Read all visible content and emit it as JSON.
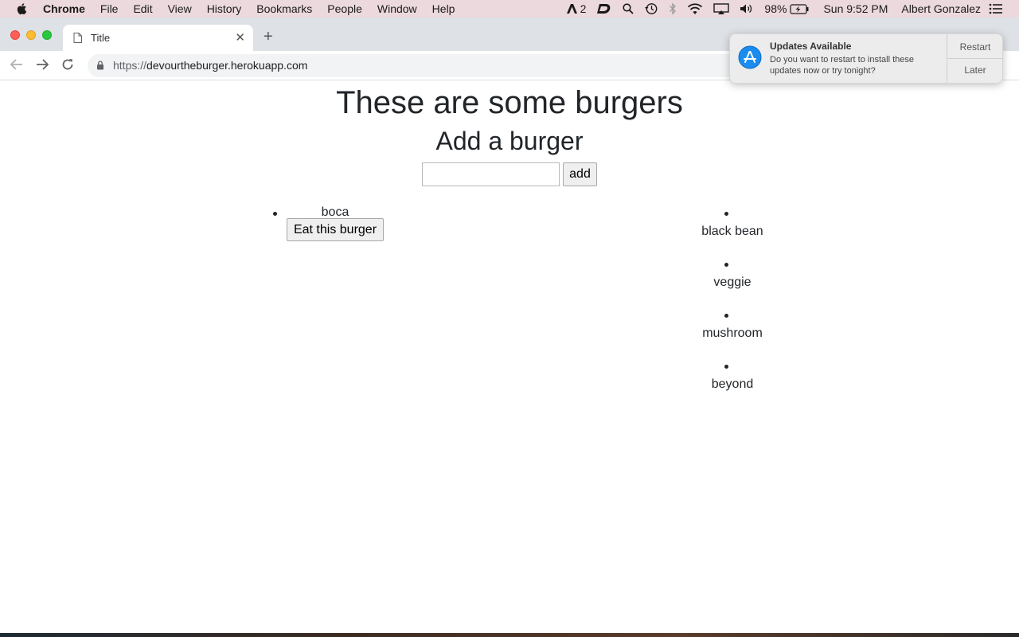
{
  "menubar": {
    "app_name": "Chrome",
    "items": [
      "File",
      "Edit",
      "View",
      "History",
      "Bookmarks",
      "People",
      "Window",
      "Help"
    ],
    "status": {
      "adobe_badge": "2",
      "battery": "98%",
      "clock": "Sun 9:52 PM",
      "user": "Albert Gonzalez"
    }
  },
  "browser": {
    "tab_title": "Title",
    "url_scheme": "https://",
    "url_host": "devourtheburger.herokuapp.com"
  },
  "page": {
    "title": "These are some burgers",
    "add_heading": "Add a burger",
    "input_value": "",
    "add_button": "add",
    "uneaten": [
      {
        "name": "boca",
        "button": "Eat this burger"
      }
    ],
    "devoured": [
      "black bean",
      "veggie",
      "mushroom",
      "beyond"
    ]
  },
  "notification": {
    "title": "Updates Available",
    "body": "Do you want to restart to install these updates now or try tonight?",
    "action_primary": "Restart",
    "action_secondary": "Later"
  }
}
